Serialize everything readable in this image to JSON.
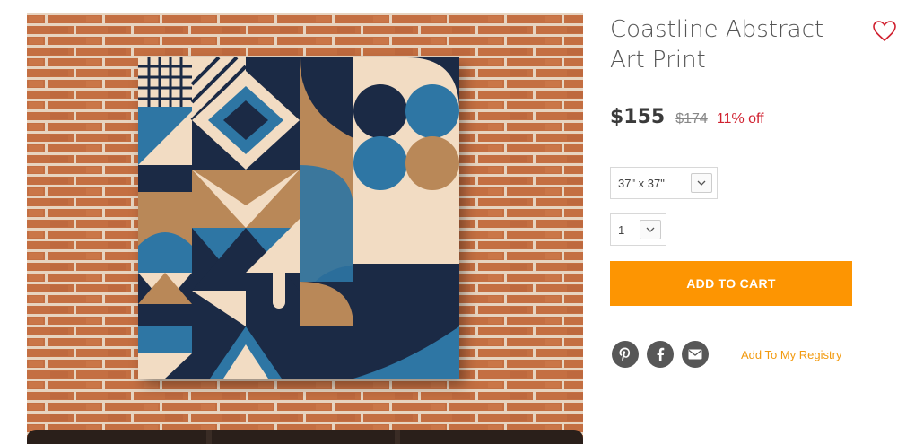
{
  "product": {
    "title": "Coastline Abstract Art Print",
    "price": "$155",
    "original_price": "$174",
    "discount": "11% off"
  },
  "options": {
    "size": "37\" x 37\"",
    "quantity": "1"
  },
  "actions": {
    "add_to_cart": "ADD TO CART",
    "registry": "Add To My Registry"
  },
  "icons": {
    "wishlist": "heart-outline-icon",
    "share": [
      "pinterest-icon",
      "facebook-icon",
      "email-icon"
    ],
    "dropdown": "chevron-down-icon"
  },
  "colors": {
    "accent_orange": "#fd9502",
    "discount_red": "#d0202f",
    "link_orange": "#f29a0f",
    "heart_red": "#d0202f",
    "art_navy": "#1b2a45",
    "art_blue": "#2e76a4",
    "art_cream": "#f2dcc3",
    "art_tan": "#b98858"
  }
}
